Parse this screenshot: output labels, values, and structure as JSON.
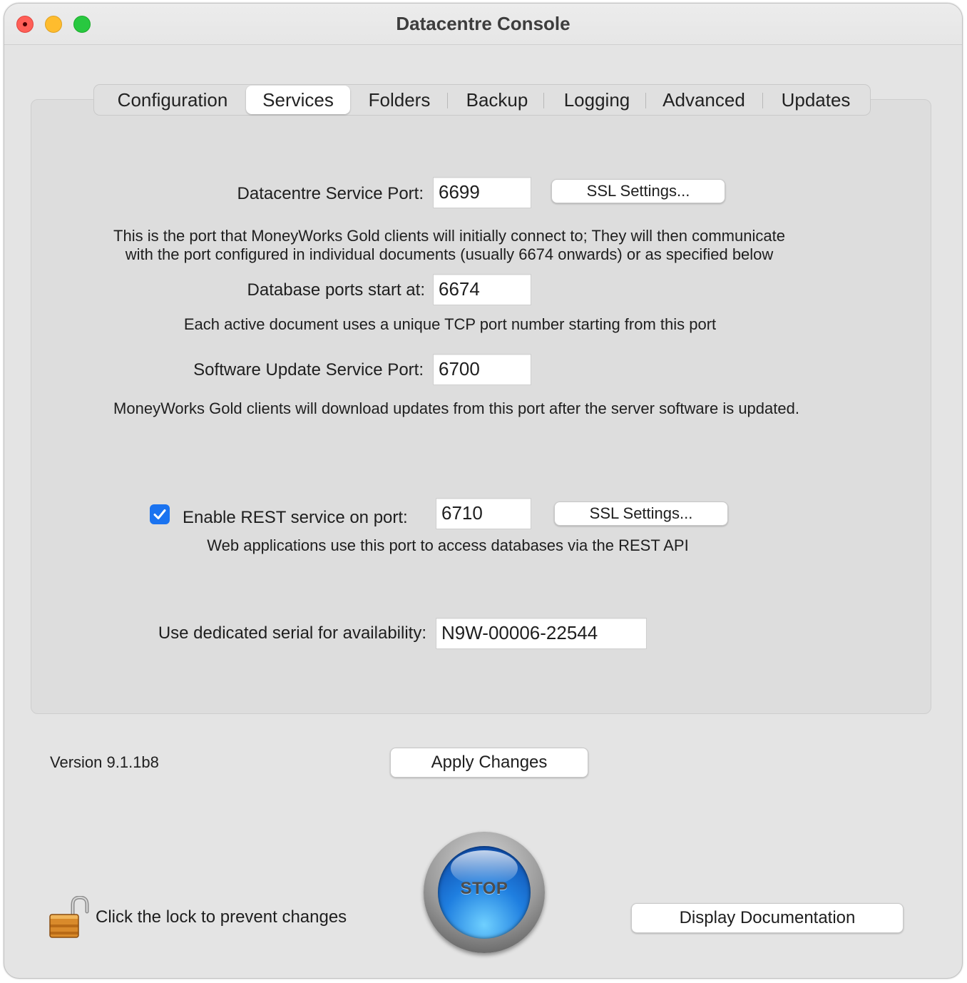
{
  "window": {
    "title": "Datacentre Console"
  },
  "tabs": [
    {
      "label": "Configuration",
      "active": false
    },
    {
      "label": "Services",
      "active": true
    },
    {
      "label": "Folders",
      "active": false
    },
    {
      "label": "Backup",
      "active": false
    },
    {
      "label": "Logging",
      "active": false
    },
    {
      "label": "Advanced",
      "active": false
    },
    {
      "label": "Updates",
      "active": false
    }
  ],
  "services": {
    "datacentre_port": {
      "label": "Datacentre Service Port:",
      "value": "6699",
      "ssl_button": "SSL Settings..."
    },
    "datacentre_desc_line1": "This is the port that MoneyWorks Gold clients will initially connect to; They will then communicate",
    "datacentre_desc_line2": "with the port configured in individual documents (usually 6674 onwards) or as specified below",
    "db_ports": {
      "label": "Database ports start at:",
      "value": "6674"
    },
    "db_ports_desc": "Each active document uses a unique TCP port number starting from this port",
    "update_port": {
      "label": "Software Update Service Port:",
      "value": "6700"
    },
    "update_desc": "MoneyWorks Gold clients will download updates from this port after the server software is updated.",
    "rest": {
      "checked": true,
      "label": "Enable REST service on port:",
      "value": "6710",
      "ssl_button": "SSL Settings...",
      "desc": "Web applications use this port to access databases via the REST API"
    },
    "serial": {
      "label": "Use dedicated serial for availability:",
      "value": "N9W-00006-22544"
    }
  },
  "footer": {
    "version": "Version 9.1.1b8",
    "apply_button": "Apply Changes",
    "lock_text": "Click the lock to prevent changes",
    "stop_button": "STOP",
    "docs_button": "Display Documentation"
  },
  "colors": {
    "accent": "#1a73f0",
    "window_bg": "#e4e4e4",
    "panel_bg": "#dddddd"
  }
}
